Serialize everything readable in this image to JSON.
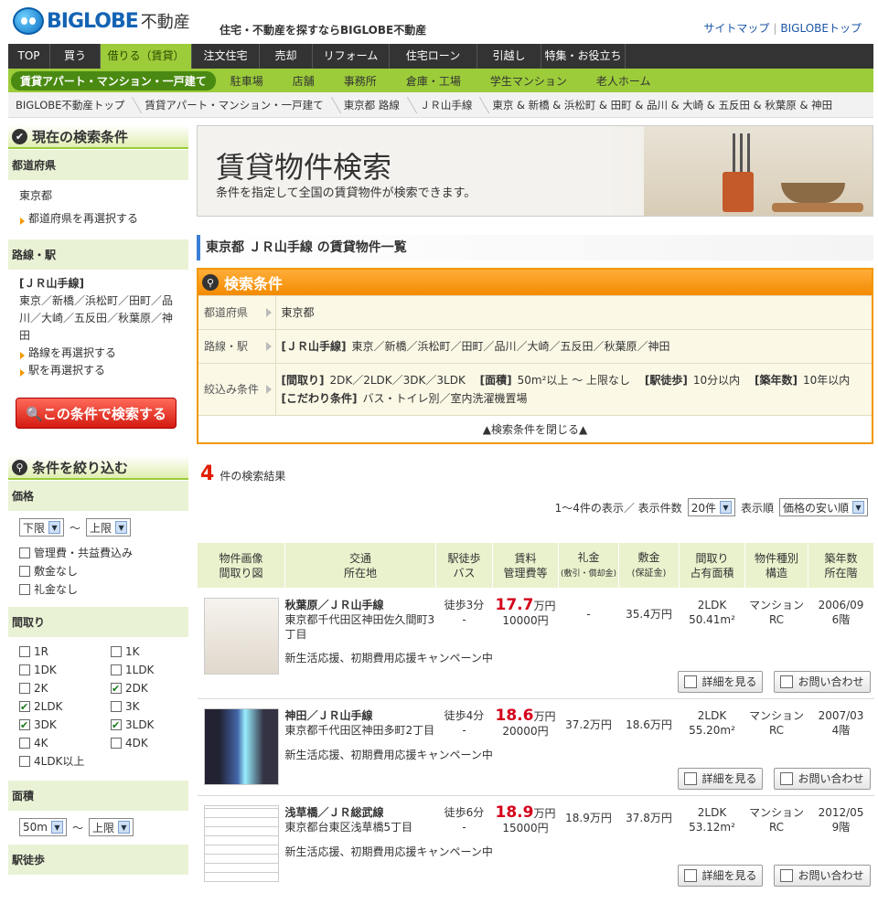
{
  "header": {
    "brand": "BIGLOBE",
    "fudosan": "不動産",
    "tagline": "住宅・不動産を探すならBIGLOBE不動産",
    "links": [
      "サイトマップ",
      "BIGLOBEトップ"
    ]
  },
  "nav": [
    "TOP",
    "買う",
    "借りる（賃貸）",
    "注文住宅",
    "売却",
    "リフォーム",
    "住宅ローン",
    "引越し",
    "特集・お役立ち"
  ],
  "subnav": [
    "賃貸アパート・マンション・一戸建て",
    "駐車場",
    "店舗",
    "事務所",
    "倉庫・工場",
    "学生マンション",
    "老人ホーム"
  ],
  "breadcrumb": [
    "BIGLOBE不動産トップ",
    "賃貸アパート・マンション・一戸建て",
    "東京都 路線",
    "ＪＲ山手線",
    "東京 & 新橋 & 浜松町 & 田町 & 品川 & 大崎 & 五反田 & 秋葉原 & 神田"
  ],
  "sidebar": {
    "current_title": "現在の検索条件",
    "pref_label": "都道府県",
    "pref_value": "東京都",
    "pref_link": "都道府県を再選択する",
    "line_label": "路線・駅",
    "line_name": "[ＪＲ山手線]",
    "line_stations": "東京／新橋／浜松町／田町／品川／大崎／五反田／秋葉原／神田",
    "line_link1": "路線を再選択する",
    "line_link2": "駅を再選択する",
    "search_button": "この条件で検索する",
    "narrow_title": "条件を絞り込む",
    "price_label": "価格",
    "price_min": "下限",
    "price_sep": "～",
    "price_max": "上限",
    "price_checks": [
      "管理費・共益費込み",
      "敷金なし",
      "礼金なし"
    ],
    "madori_label": "間取り",
    "madori": [
      [
        "1R",
        "1K"
      ],
      [
        "1DK",
        "1LDK"
      ],
      [
        "2K",
        "2DK"
      ],
      [
        "2LDK",
        "3K"
      ],
      [
        "3DK",
        "3LDK"
      ],
      [
        "4K",
        "4DK"
      ],
      [
        "4LDK以上",
        ""
      ]
    ],
    "area_label": "面積",
    "area_min": "50m",
    "area_max": "上限",
    "walk_label": "駅徒歩"
  },
  "main": {
    "banner_title": "賃貸物件検索",
    "banner_sub": "条件を指定して全国の賃貸物件が検索できます。",
    "list_title": "東京都 ＪＲ山手線 の賃貸物件一覧",
    "cond_title": "検索条件",
    "cond": {
      "pref_k": "都道府県",
      "pref_v": "東京都",
      "line_k": "路線・駅",
      "line_b": "[ＪＲ山手線]",
      "line_v": "東京／新橋／浜松町／田町／品川／大崎／五反田／秋葉原／神田",
      "filter_k": "絞込み条件",
      "f1b": "[間取り]",
      "f1v": "2DK／2LDK／3DK／3LDK",
      "f2b": "[面積]",
      "f2v": "50m²以上 ～ 上限なし",
      "f3b": "[駅徒歩]",
      "f3v": "10分以内",
      "f4b": "[築年数]",
      "f4v": "10年以内",
      "f5b": "[こだわり条件]",
      "f5v": "バス・トイレ別／室内洗濯機置場",
      "close": "▲検索条件を閉じる▲"
    },
    "count": "4",
    "count_suffix": "件の検索結果",
    "range": "1～4件の表示／ 表示件数",
    "per_page": "20件",
    "sort_label": "表示順",
    "sort": "価格の安い順"
  },
  "table": {
    "headers": [
      [
        "物件画像",
        "間取り図"
      ],
      [
        "交通",
        "所在地"
      ],
      [
        "駅徒歩",
        "バス"
      ],
      [
        "賃料",
        "管理費等"
      ],
      [
        "礼金",
        "(敷引・償却金)"
      ],
      [
        "敷金",
        "(保証金)"
      ],
      [
        "間取り",
        "占有面積"
      ],
      [
        "物件種別",
        "構造"
      ],
      [
        "築年数",
        "所在階"
      ]
    ],
    "rows": [
      {
        "name": "秋葉原／ＪＲ山手線",
        "addr": "東京都千代田区神田佐久間町3丁目",
        "walk": "徒歩3分",
        "bus": "-",
        "price": "17.7",
        "unit": "万円",
        "fee": "10000円",
        "reikin": "-",
        "shikikin": "35.4万円",
        "madori": "2LDK",
        "area": "50.41m²",
        "type": "マンション",
        "struct": "RC",
        "built": "2006/09",
        "floor": "6階",
        "note": "新生活応援、初期費用応援キャンペーン中"
      },
      {
        "name": "神田／ＪＲ山手線",
        "addr": "東京都千代田区神田多町2丁目",
        "walk": "徒歩4分",
        "bus": "-",
        "price": "18.6",
        "unit": "万円",
        "fee": "20000円",
        "reikin": "37.2万円",
        "shikikin": "18.6万円",
        "madori": "2LDK",
        "area": "55.20m²",
        "type": "マンション",
        "struct": "RC",
        "built": "2007/03",
        "floor": "4階",
        "note": "新生活応援、初期費用応援キャンペーン中"
      },
      {
        "name": "浅草橋／ＪＲ総武線",
        "addr": "東京都台東区浅草橋5丁目",
        "walk": "徒歩6分",
        "bus": "-",
        "price": "18.9",
        "unit": "万円",
        "fee": "15000円",
        "reikin": "18.9万円",
        "shikikin": "37.8万円",
        "madori": "2LDK",
        "area": "53.12m²",
        "type": "マンション",
        "struct": "RC",
        "built": "2012/05",
        "floor": "9階",
        "note": "新生活応援、初期費用応援キャンペーン中"
      }
    ],
    "detail_btn": "詳細を見る",
    "contact_btn": "お問い合わせ"
  }
}
